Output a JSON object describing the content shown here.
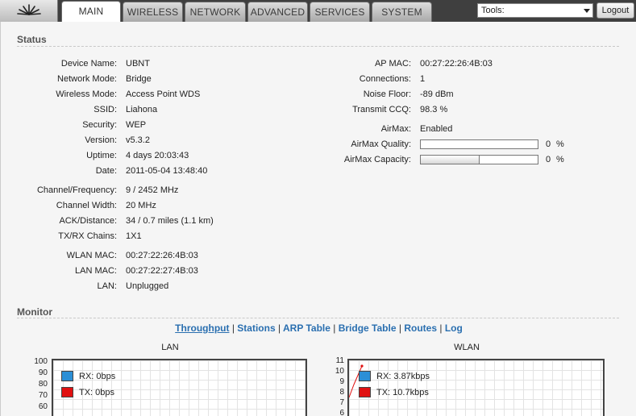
{
  "nav": {
    "tabs": [
      "MAIN",
      "WIRELESS",
      "NETWORK",
      "ADVANCED",
      "SERVICES",
      "SYSTEM"
    ],
    "active_tab": "MAIN",
    "tools_value": "Tools:",
    "logout_label": "Logout"
  },
  "status": {
    "title": "Status",
    "left": [
      {
        "label": "Device Name:",
        "value": "UBNT"
      },
      {
        "label": "Network Mode:",
        "value": "Bridge"
      },
      {
        "label": "Wireless Mode:",
        "value": "Access Point WDS"
      },
      {
        "label": "SSID:",
        "value": "Liahona"
      },
      {
        "label": "Security:",
        "value": "WEP"
      },
      {
        "label": "Version:",
        "value": "v5.3.2"
      },
      {
        "label": "Uptime:",
        "value": "4 days 20:03:43"
      },
      {
        "label": "Date:",
        "value": "2011-05-04 13:48:40"
      },
      {
        "label": "Channel/Frequency:",
        "value": "9  /  2452 MHz"
      },
      {
        "label": "Channel Width:",
        "value": "20 MHz"
      },
      {
        "label": "ACK/Distance:",
        "value": "34 / 0.7 miles (1.1 km)"
      },
      {
        "label": "TX/RX Chains:",
        "value": "1X1"
      },
      {
        "label": "WLAN MAC:",
        "value": "00:27:22:26:4B:03"
      },
      {
        "label": "LAN MAC:",
        "value": "00:27:22:27:4B:03"
      },
      {
        "label": "LAN:",
        "value": "Unplugged"
      }
    ],
    "right": [
      {
        "label": "AP MAC:",
        "value": "00:27:22:26:4B:03"
      },
      {
        "label": "Connections:",
        "value": "1"
      },
      {
        "label": "Noise Floor:",
        "value": "-89 dBm"
      },
      {
        "label": "Transmit CCQ:",
        "value": "98.3 %"
      },
      {
        "label": "AirMax:",
        "value": "Enabled"
      }
    ],
    "airmax_quality": {
      "label": "AirMax Quality:",
      "value": "0",
      "unit": "%",
      "fill_fraction": 0.0
    },
    "airmax_capacity": {
      "label": "AirMax Capacity:",
      "value": "0",
      "unit": "%",
      "fill_fraction": 0.5
    }
  },
  "monitor": {
    "title": "Monitor",
    "links": [
      "Throughput",
      "Stations",
      "ARP Table",
      "Bridge Table",
      "Routes",
      "Log"
    ],
    "active_link": "Throughput",
    "separator": "|",
    "lan": {
      "title": "LAN",
      "yticks": [
        "100",
        "90",
        "80",
        "70",
        "60"
      ],
      "rx": "RX: 0bps",
      "tx": "TX: 0bps"
    },
    "wlan": {
      "title": "WLAN",
      "yticks": [
        "11",
        "10",
        "9",
        "8",
        "7",
        "6"
      ],
      "rx": "RX: 3.87kbps",
      "tx": "TX: 10.7kbps"
    },
    "colors": {
      "rx": "#2b8fd6",
      "tx": "#e01010"
    }
  }
}
